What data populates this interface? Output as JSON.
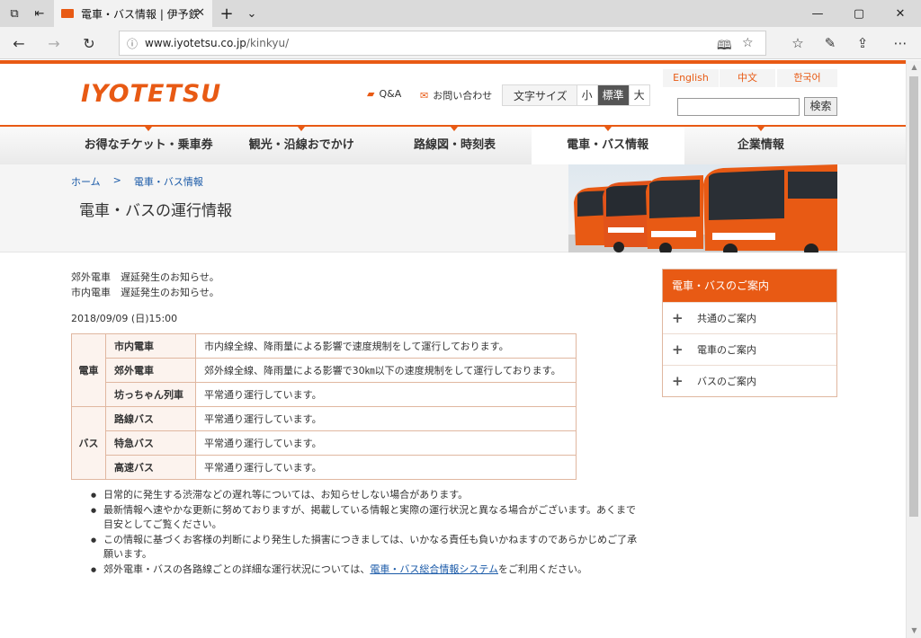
{
  "browser": {
    "tab_title": "電車・バス情報 | 伊予鉄",
    "url_host": "www.iyotetsu.co.jp",
    "url_path": "/kinkyu/"
  },
  "header": {
    "logo": "IYOTETSU",
    "qa": "Q&A",
    "contact": "お問い合わせ",
    "font_size_label": "文字サイズ",
    "font_sizes": [
      "小",
      "標準",
      "大"
    ],
    "languages": [
      "English",
      "中文",
      "한국어"
    ],
    "search_button": "検索",
    "search_value": ""
  },
  "gnav": {
    "items": [
      "お得なチケット・乗車券",
      "観光・沿線おでかけ",
      "路線図・時刻表",
      "電車・バス情報",
      "企業情報"
    ],
    "active_index": 3
  },
  "breadcrumb": [
    "ホーム",
    ">",
    "電車・バス情報"
  ],
  "page_title": "電車・バスの運行情報",
  "notices": [
    "郊外電車　遅延発生のお知らせ。",
    "市内電車　遅延発生のお知らせ。"
  ],
  "date": "2018/09/09 (日)15:00",
  "status": {
    "train_label": "電車",
    "bus_label": "バス",
    "rows": [
      {
        "line": "市内電車",
        "status": "市内線全線、降雨量による影響で速度規制をして運行しております。"
      },
      {
        "line": "郊外電車",
        "status": "郊外線全線、降雨量による影響で30㎞以下の速度規制をして運行しております。"
      },
      {
        "line": "坊っちゃん列車",
        "status": "平常通り運行しています。"
      },
      {
        "line": "路線バス",
        "status": "平常通り運行しています。"
      },
      {
        "line": "特急バス",
        "status": "平常通り運行しています。"
      },
      {
        "line": "高速バス",
        "status": "平常通り運行しています。"
      }
    ]
  },
  "notes": {
    "n1": "日常的に発生する渋滞などの遅れ等については、お知らせしない場合があります。",
    "n2": "最新情報へ速やかな更新に努めておりますが、掲載している情報と実際の運行状況と異なる場合がございます。あくまで目安としてご覧ください。",
    "n3": "この情報に基づくお客様の判断により発生した損害につきましては、いかなる責任も負いかねますのであらかじめご了承願います。",
    "n4_before": "郊外電車・バスの各路線ごとの詳細な運行状況については、",
    "n4_link": "電車・バス総合情報システム",
    "n4_after": "をご利用ください。"
  },
  "side_menu": {
    "title": "電車・バスのご案内",
    "items": [
      "共通のご案内",
      "電車のご案内",
      "バスのご案内"
    ]
  },
  "colors": {
    "brand_orange": "#e85a14",
    "link_blue": "#1a5aa8",
    "table_border": "#e0b7a0"
  }
}
